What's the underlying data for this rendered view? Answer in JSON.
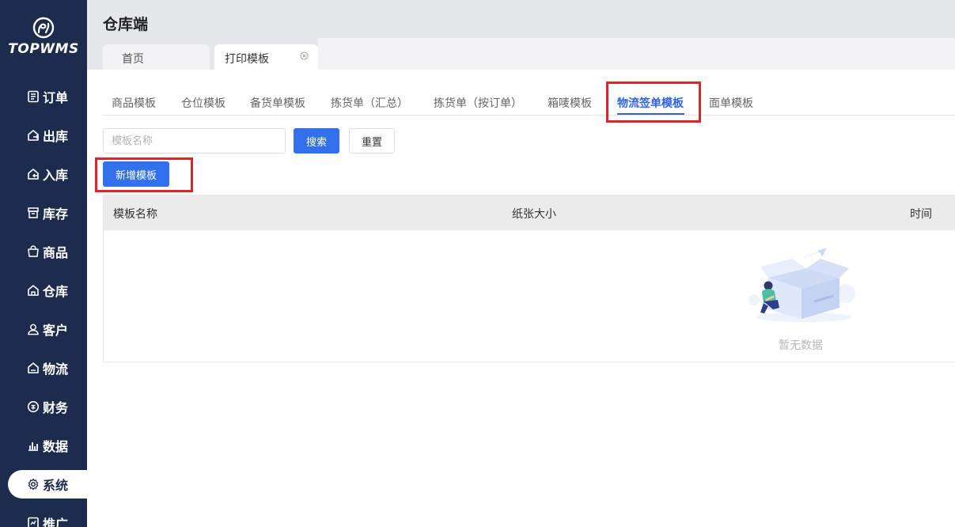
{
  "brand": {
    "name": "TOPWMS",
    "app_title": "仓库端"
  },
  "sidebar": {
    "items": [
      {
        "label": "订单",
        "icon": "order-icon"
      },
      {
        "label": "出库",
        "icon": "outbound-icon"
      },
      {
        "label": "入库",
        "icon": "inbound-icon"
      },
      {
        "label": "库存",
        "icon": "inventory-icon"
      },
      {
        "label": "商品",
        "icon": "product-icon"
      },
      {
        "label": "仓库",
        "icon": "warehouse-icon"
      },
      {
        "label": "客户",
        "icon": "customer-icon"
      },
      {
        "label": "物流",
        "icon": "logistics-icon"
      },
      {
        "label": "财务",
        "icon": "finance-icon"
      },
      {
        "label": "数据",
        "icon": "data-icon"
      },
      {
        "label": "系统",
        "icon": "gear-icon",
        "active": true
      },
      {
        "label": "推广",
        "icon": "promote-icon"
      }
    ]
  },
  "page_tabs": [
    {
      "label": "首页"
    },
    {
      "label": "打印模板",
      "active": true,
      "closable": true
    }
  ],
  "sub_tabs": [
    {
      "label": "商品模板"
    },
    {
      "label": "仓位模板"
    },
    {
      "label": "备货单模板"
    },
    {
      "label": "拣货单（汇总）"
    },
    {
      "label": "拣货单（按订单）"
    },
    {
      "label": "箱唛模板"
    },
    {
      "label": "物流签单模板",
      "active": true
    },
    {
      "label": "面单模板"
    }
  ],
  "search": {
    "placeholder": "模板名称",
    "value": "",
    "search_label": "搜索",
    "reset_label": "重置"
  },
  "add_button_label": "新增模板",
  "table": {
    "columns": [
      "模板名称",
      "纸张大小",
      "时间"
    ],
    "rows": [],
    "empty_text": "暂无数据"
  },
  "colors": {
    "sidebar_bg": "#1d2c4e",
    "primary": "#3370ee",
    "highlight": "#e0242b",
    "active_tab": "#2f62e8"
  }
}
